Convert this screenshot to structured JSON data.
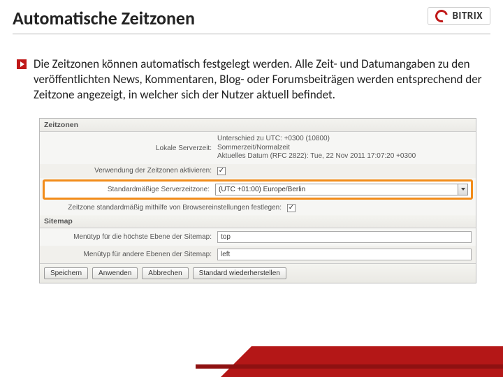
{
  "header": {
    "title": "Automatische Zeitzonen",
    "logo_text": "BITRIX"
  },
  "paragraph": "Die Zeitzonen können automatisch festgelegt werden. Alle Zeit- und Datumangaben zu den veröffentlichten News, Kommentaren, Blog- oder Forumsbeiträgen werden entsprechend der Zeitzone angezeigt, in welcher sich der Nutzer aktuell befindet.",
  "panel": {
    "section_timezones": "Zeitzonen",
    "local_server_label": "Lokale Serverzeit:",
    "local_server_value": "Unterschied zu UTC: +0300 (10800)\nSommerzeit/Normalzeit\nAktuelles Datum (RFC 2822): Tue, 22 Nov 2011 17:07:20 +0300",
    "tz_enable_label": "Verwendung der Zeitzonen aktivieren:",
    "tz_enable_checked": "✓",
    "default_tz_label": "Standardmäßige Serverzeitzone:",
    "default_tz_value": "(UTC +01:00) Europe/Berlin",
    "browser_tz_label": "Zeitzone standardmäßig mithilfe von Browsereinstellungen festlegen:",
    "browser_tz_checked": "✓",
    "section_sitemap": "Sitemap",
    "menu_top_label": "Menütyp für die höchste Ebene der Sitemap:",
    "menu_top_value": "top",
    "menu_other_label": "Menütyp für andere Ebenen der Sitemap:",
    "menu_other_value": "left",
    "buttons": {
      "save": "Speichern",
      "apply": "Anwenden",
      "cancel": "Abbrechen",
      "reset": "Standard wiederherstellen"
    }
  }
}
